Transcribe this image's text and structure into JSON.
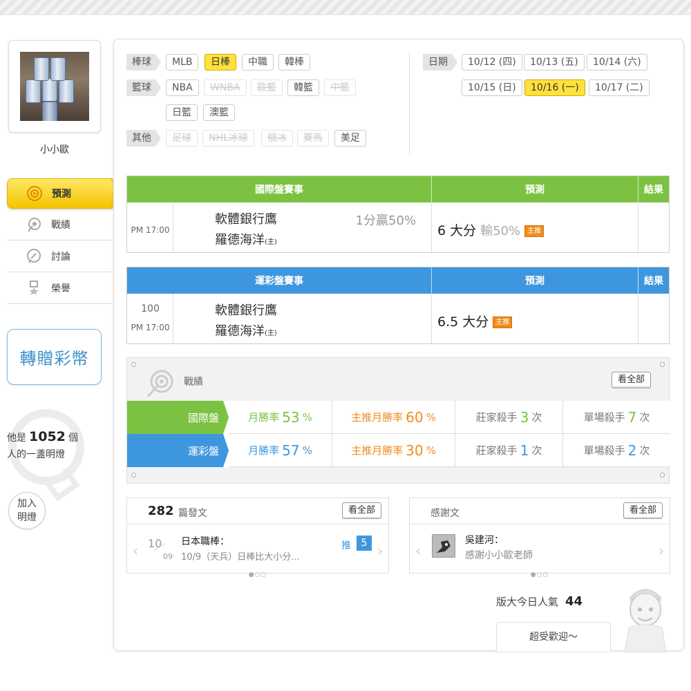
{
  "user": {
    "name": "小小歐"
  },
  "nav": [
    {
      "label": "預測",
      "icon": "target-icon",
      "active": true
    },
    {
      "label": "戰績",
      "icon": "record-icon",
      "active": false
    },
    {
      "label": "討論",
      "icon": "discussion-icon",
      "active": false
    },
    {
      "label": "榮譽",
      "icon": "honor-icon",
      "active": false
    }
  ],
  "transfer_label": "轉贈彩幣",
  "light": {
    "prefix": "他是",
    "count": "1052",
    "suffix": "個",
    "line2": "人的一盞明燈",
    "join_line1": "加入",
    "join_line2": "明燈"
  },
  "filters": {
    "baseball": {
      "label": "棒球",
      "items": [
        "MLB",
        "日棒",
        "中職",
        "韓棒"
      ],
      "selected": "日棒"
    },
    "basketball": {
      "label": "籃球",
      "items": [
        "NBA",
        "WNBA",
        "歐籃",
        "韓籃",
        "中籃",
        "日籃",
        "澳籃"
      ],
      "disabled": [
        "WNBA",
        "歐籃",
        "中籃"
      ]
    },
    "other": {
      "label": "其他",
      "items": [
        "足球",
        "NHL冰球",
        "俄冰",
        "賽馬",
        "美足"
      ],
      "disabled": [
        "足球",
        "NHL冰球",
        "俄冰",
        "賽馬"
      ]
    },
    "date": {
      "label": "日期",
      "items": [
        "10/12 (四)",
        "10/13 (五)",
        "10/14 (六)",
        "10/15 (日)",
        "10/16 (一)",
        "10/17 (二)"
      ],
      "selected": "10/16 (一)"
    }
  },
  "intl_table": {
    "color": "#7cc242",
    "headers": {
      "event": "國際盤賽事",
      "prediction": "預測",
      "result": "結果"
    },
    "row": {
      "time": "PM 17:00",
      "team1": "軟體銀行鷹",
      "team2": "羅德海洋",
      "home": "(主)",
      "odds": "1分贏50%",
      "pred": "6 大分",
      "lose": "輸50%",
      "tag": "主推"
    }
  },
  "lottery_table": {
    "color": "#3e97de",
    "headers": {
      "event": "運彩盤賽事",
      "prediction": "預測",
      "result": "結果"
    },
    "row": {
      "code": "100",
      "time": "PM 17:00",
      "team1": "軟體銀行鷹",
      "team2": "羅德海洋",
      "home": "(主)",
      "pred": "6.5 大分",
      "tag": "主推"
    }
  },
  "record": {
    "title": "戰績",
    "see_all": "看全部",
    "rows": [
      {
        "label": "國際盤",
        "color": "#7cc242",
        "monthly_label": "月勝率",
        "monthly": "53",
        "main_label": "主推月勝率",
        "main": "60",
        "banker_label": "莊家殺手",
        "banker": "3",
        "single_label": "單場殺手",
        "single": "7",
        "unit_pct": "%",
        "unit_times": "次"
      },
      {
        "label": "運彩盤",
        "color": "#3e97de",
        "monthly_label": "月勝率",
        "monthly": "57",
        "main_label": "主推月勝率",
        "main": "30",
        "banker_label": "莊家殺手",
        "banker": "1",
        "single_label": "單場殺手",
        "single": "2",
        "unit_pct": "%",
        "unit_times": "次"
      }
    ]
  },
  "posts": {
    "count": "282",
    "label": "篇發文",
    "see_all": "看全部",
    "item": {
      "month": "10",
      "day": "09",
      "title": "日本職棒：",
      "desc": "10/9（天兵）日棒比大小分...",
      "push_label": "推",
      "push": "5"
    }
  },
  "thanks": {
    "label": "感謝文",
    "see_all": "看全部",
    "item": {
      "author": "吳建河：",
      "text": "感謝小小歐老師"
    }
  },
  "popularity": {
    "label": "版大今日人氣",
    "value": "44",
    "welcome": "超受歡迎～"
  }
}
